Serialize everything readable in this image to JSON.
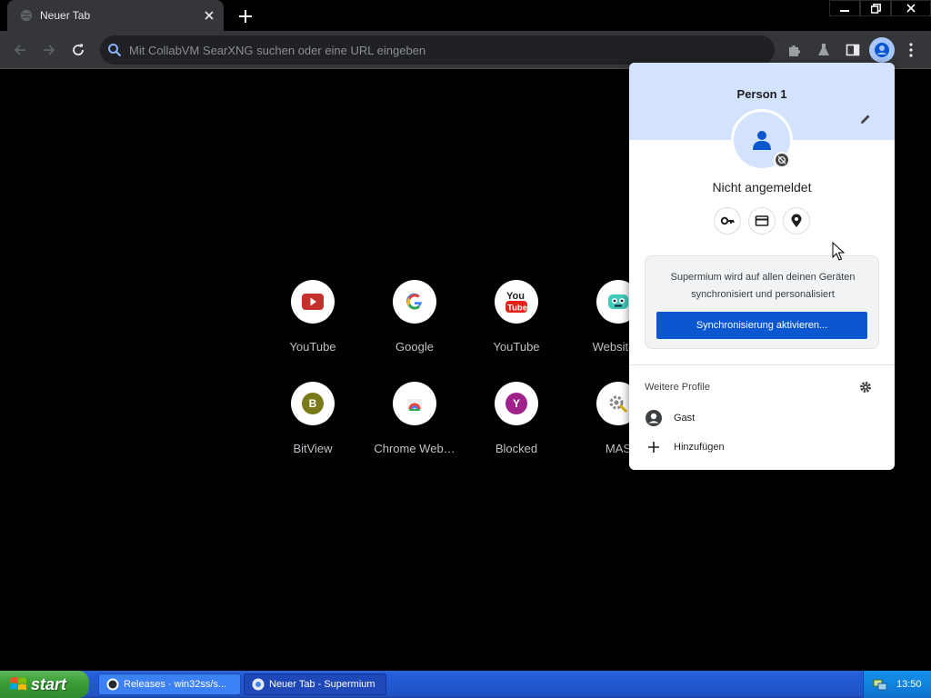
{
  "browser": {
    "tab_title": "Neuer Tab",
    "omnibox_placeholder": "Mit CollabVM SearXNG suchen oder eine URL eingeben"
  },
  "shortcuts": [
    {
      "label": "YouTube",
      "icon": "youtube-play-icon"
    },
    {
      "label": "Google",
      "icon": "google-g-icon"
    },
    {
      "label": "YouTube",
      "icon": "youtube-logo-icon"
    },
    {
      "label": "Website ti",
      "icon": "robot-icon"
    },
    {
      "label": "BitView",
      "icon": "letter-b-icon",
      "letter": "B",
      "color": "#7a7a1a"
    },
    {
      "label": "Chrome Web…",
      "icon": "chrome-webstore-icon"
    },
    {
      "label": "Blocked",
      "icon": "letter-y-icon",
      "letter": "Y",
      "color": "#a0208c"
    },
    {
      "label": "MAS",
      "icon": "gear-key-icon"
    }
  ],
  "profile_menu": {
    "name": "Person 1",
    "status": "Nicht angemeldet",
    "sync_text": "Supermium wird auf allen deinen Geräten synchronisiert und personalisiert",
    "sync_button": "Synchronisierung aktivieren...",
    "more_profiles": "Weitere Profile",
    "guest": "Gast",
    "add": "Hinzufügen"
  },
  "taskbar": {
    "start": "start",
    "tasks": [
      {
        "label": "Releases · win32ss/s..."
      },
      {
        "label": "Neuer Tab - Supermium"
      }
    ],
    "clock": "13:50"
  },
  "colors": {
    "accent": "#0b57d0",
    "header": "#d3e3fd",
    "toolbar": "#35363a"
  }
}
